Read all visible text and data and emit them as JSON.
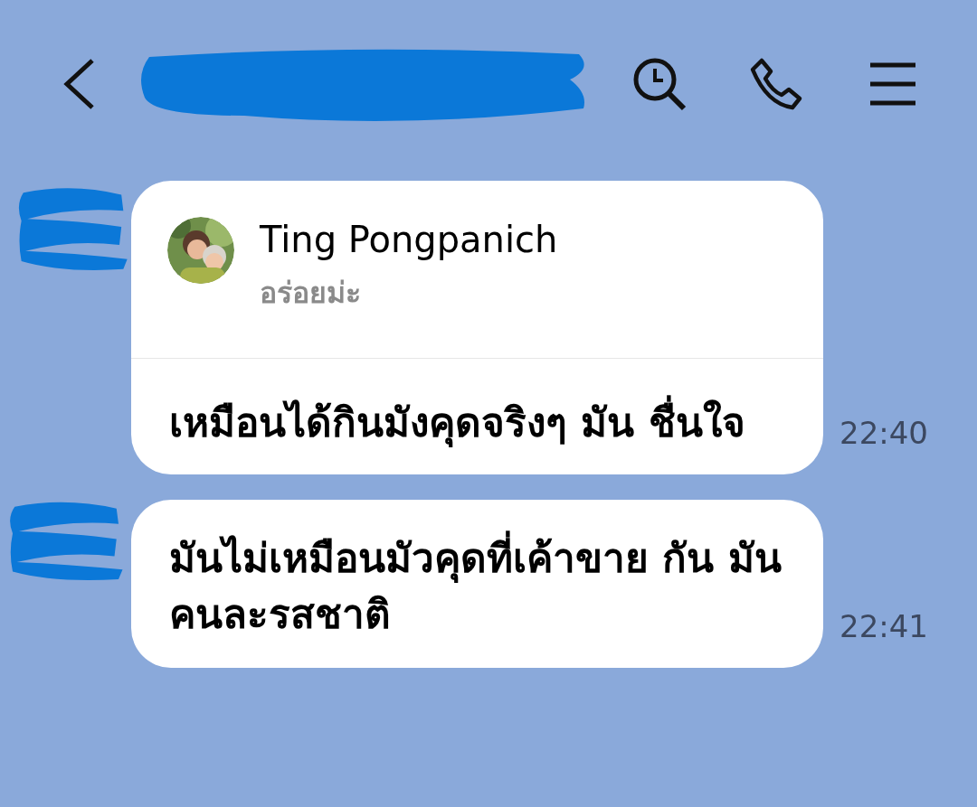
{
  "messages": [
    {
      "kind": "reply",
      "quote": {
        "sender": "Ting Pongpanich",
        "text": "อร่อยม่ะ"
      },
      "text": "เหมือนได้กินมังคุดจริงๆ มัน ชื่นใจ",
      "time": "22:40"
    },
    {
      "kind": "plain",
      "text": "มันไม่เหมือนมัวคุดที่เค้าขาย กัน มันคนละรสชาติ",
      "time": "22:41"
    }
  ]
}
